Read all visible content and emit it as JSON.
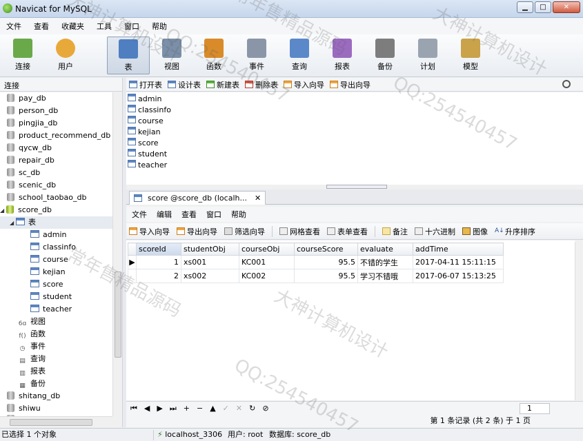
{
  "window": {
    "title": "Navicat for MySQL",
    "controls": [
      "▁",
      "□",
      "✕"
    ]
  },
  "menu": [
    "文件",
    "查看",
    "收藏夹",
    "工具",
    "窗口",
    "帮助"
  ],
  "toolbar": [
    {
      "label": "连接",
      "icon": "connection-icon",
      "color": "#6aa94a"
    },
    {
      "label": "用户",
      "icon": "user-icon",
      "color": "#e8a93b"
    },
    {
      "label": "表",
      "icon": "table-icon",
      "color": "#4f7fc1",
      "active": true
    },
    {
      "label": "视图",
      "icon": "view-icon",
      "color": "#7b8fa8"
    },
    {
      "label": "函数",
      "icon": "function-icon",
      "color": "#d98b2a"
    },
    {
      "label": "事件",
      "icon": "event-icon",
      "color": "#8a96a8"
    },
    {
      "label": "查询",
      "icon": "query-icon",
      "color": "#5b88c9"
    },
    {
      "label": "报表",
      "icon": "report-icon",
      "color": "#9b6bc0"
    },
    {
      "label": "备份",
      "icon": "backup-icon",
      "color": "#7d7d7d"
    },
    {
      "label": "计划",
      "icon": "schedule-icon",
      "color": "#9aa4b1"
    },
    {
      "label": "模型",
      "icon": "model-icon",
      "color": "#c9a24a"
    }
  ],
  "left_panel": {
    "header": "连接",
    "databases_above": [
      "pay_db",
      "person_db",
      "pingjia_db",
      "product_recommend_db",
      "qycw_db",
      "repair_db",
      "sc_db",
      "scenic_db",
      "school_taobao_db"
    ],
    "active_db": "score_db",
    "tables_node": "表",
    "tables": [
      "admin",
      "classinfo",
      "course",
      "kejian",
      "score",
      "student",
      "teacher"
    ],
    "other_nodes": [
      {
        "label": "视图",
        "icon": "view-icon",
        "glyph": "6ɑ"
      },
      {
        "label": "函数",
        "icon": "function-icon",
        "glyph": "f()"
      },
      {
        "label": "事件",
        "icon": "event-icon",
        "glyph": "◷"
      },
      {
        "label": "查询",
        "icon": "query-icon",
        "glyph": "▤"
      },
      {
        "label": "报表",
        "icon": "report-icon",
        "glyph": "▥"
      },
      {
        "label": "备份",
        "icon": "backup-icon",
        "glyph": "▦"
      }
    ],
    "databases_below": [
      "shitang_db",
      "shiwu",
      "shujuku_db"
    ]
  },
  "object_toolbar": [
    {
      "label": "打开表",
      "color": "blue"
    },
    {
      "label": "设计表",
      "color": "blue"
    },
    {
      "label": "新建表",
      "color": "green"
    },
    {
      "label": "删除表",
      "color": "red"
    },
    {
      "label": "导入向导",
      "color": "orange"
    },
    {
      "label": "导出向导",
      "color": "orange"
    }
  ],
  "object_list": [
    "admin",
    "classinfo",
    "course",
    "kejian",
    "score",
    "student",
    "teacher"
  ],
  "tab": {
    "label": "score @score_db (localh...",
    "close": "✕"
  },
  "table_menu": [
    "文件",
    "编辑",
    "查看",
    "窗口",
    "帮助"
  ],
  "table_toolbar": [
    {
      "label": "导入向导",
      "icon": "import-icon"
    },
    {
      "label": "导出向导",
      "icon": "export-icon"
    },
    {
      "label": "筛选向导",
      "icon": "filter-icon"
    },
    {
      "label": "网格查看",
      "icon": "grid-view-icon"
    },
    {
      "label": "表单查看",
      "icon": "form-view-icon"
    },
    {
      "label": "备注",
      "icon": "memo-icon"
    },
    {
      "label": "十六进制",
      "icon": "hex-icon"
    },
    {
      "label": "图像",
      "icon": "image-icon"
    },
    {
      "label": "升序排序",
      "icon": "sort-asc-icon"
    }
  ],
  "grid": {
    "columns": [
      "scoreId",
      "studentObj",
      "courseObj",
      "courseScore",
      "evaluate",
      "addTime"
    ],
    "rows": [
      [
        "1",
        "xs001",
        "KC001",
        "95.5",
        "不错的学生",
        "2017-04-11 15:11:15"
      ],
      [
        "2",
        "xs002",
        "KC002",
        "95.5",
        "学习不错哦",
        "2017-06-07 15:13:25"
      ]
    ]
  },
  "navbar": {
    "buttons": [
      "⏮",
      "◀",
      "▶",
      "⏭",
      "+",
      "−",
      "▲",
      "✓",
      "✕",
      "↻",
      "⊘"
    ],
    "page": "1"
  },
  "record_info": "第 1 条记录 (共 2 条) 于 1 页",
  "status": {
    "left": "已选择 1 个对象",
    "connection": "localhost_3306",
    "user": "用户: root",
    "database": "数据库: score_db"
  },
  "watermarks": [
    "大神计算机设计",
    "QQ:254540457",
    "常年售精品源码",
    "大神计算机设计",
    "QQ:254540457",
    "常年售精品源码",
    "大神计算机设计",
    "QQ:254540457"
  ]
}
